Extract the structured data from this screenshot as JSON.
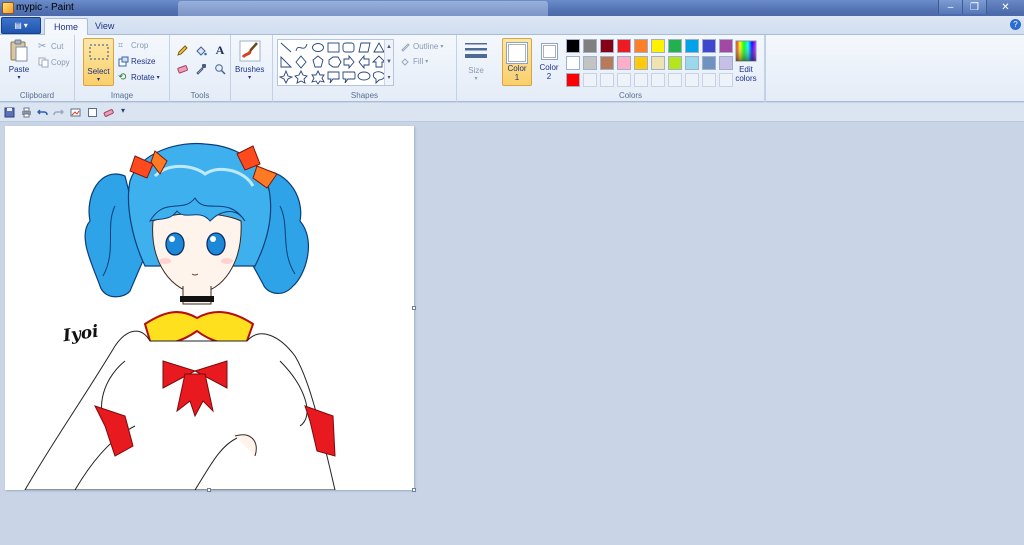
{
  "window": {
    "title": "mypic - Paint",
    "minimize": "–",
    "restore": "❐",
    "close": "✕"
  },
  "tabs": {
    "home": "Home",
    "view": "View",
    "help": "?"
  },
  "clipboard": {
    "paste": "Paste",
    "cut": "Cut",
    "copy": "Copy",
    "group": "Clipboard"
  },
  "image": {
    "select": "Select",
    "crop": "Crop",
    "resize": "Resize",
    "rotate": "Rotate",
    "group": "Image"
  },
  "tools": {
    "group": "Tools",
    "text_glyph": "A"
  },
  "brushes": {
    "label": "Brushes"
  },
  "shapes": {
    "group": "Shapes",
    "outline": "Outline",
    "fill": "Fill"
  },
  "size": {
    "label": "Size"
  },
  "colors": {
    "group": "Colors",
    "color1": "Color",
    "color1_num": "1",
    "color2": "Color",
    "color2_num": "2",
    "edit": "Edit",
    "edit2": "colors",
    "color1_value": "#ffffff",
    "color2_value": "#ffffff",
    "palette": [
      "#000000",
      "#7f7f7f",
      "#880015",
      "#ed1c24",
      "#ff7f27",
      "#fff200",
      "#22b14c",
      "#00a2e8",
      "#3f48cc",
      "#a349a4",
      "#ffffff",
      "#c3c3c3",
      "#b97a57",
      "#ffaec9",
      "#ffc90e",
      "#efe4b0",
      "#b5e61d",
      "#99d9ea",
      "#7092be",
      "#c8bfe7",
      "#ff0000",
      "",
      "",
      "",
      "",
      "",
      "",
      "",
      "",
      ""
    ]
  },
  "canvas_art": {
    "signature": "Iyoi"
  }
}
